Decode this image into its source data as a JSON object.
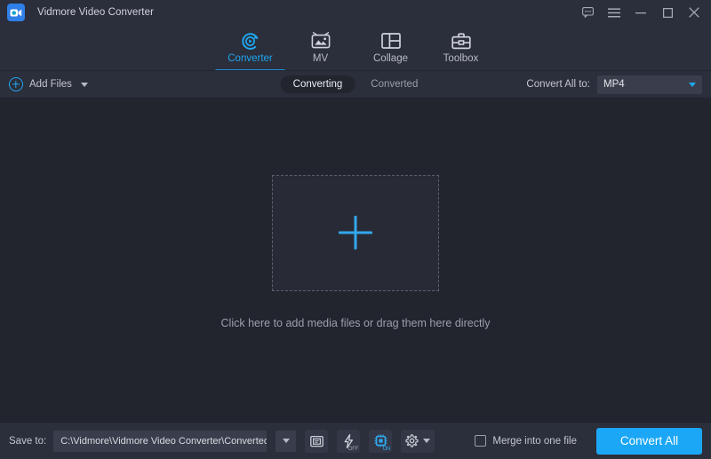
{
  "window": {
    "title": "Vidmore Video Converter",
    "logo_icon": "video-camera-icon",
    "controls": {
      "feedback_icon": "speech-bubble-icon",
      "menu_icon": "hamburger-menu-icon",
      "minimize_icon": "minimize-icon",
      "maximize_icon": "maximize-icon",
      "close_icon": "close-icon"
    }
  },
  "nav": {
    "tabs": [
      {
        "label": "Converter",
        "icon": "convert-circle-play-icon",
        "active": true
      },
      {
        "label": "MV",
        "icon": "photo-tv-icon",
        "active": false
      },
      {
        "label": "Collage",
        "icon": "collage-layout-icon",
        "active": false
      },
      {
        "label": "Toolbox",
        "icon": "toolbox-icon",
        "active": false
      }
    ]
  },
  "toolbar": {
    "add_files_label": "Add Files",
    "add_files_icon": "plus-circle-icon",
    "add_files_caret_icon": "chevron-down-icon",
    "segments": [
      {
        "label": "Converting",
        "active": true
      },
      {
        "label": "Converted",
        "active": false
      }
    ],
    "convert_all_to_label": "Convert All to:",
    "format_value": "MP4",
    "format_caret_icon": "chevron-down-icon"
  },
  "main": {
    "dropzone_plus_icon": "plus-icon",
    "hint": "Click here to add media files or drag them here directly"
  },
  "bottom": {
    "save_to_label": "Save to:",
    "save_to_path": "C:\\Vidmore\\Vidmore Video Converter\\Converted",
    "path_caret_icon": "chevron-down-icon",
    "tools": [
      {
        "name": "open-folder-icon",
        "badge": ""
      },
      {
        "name": "hardware-acceleration-bolt-icon",
        "badge": "OFF"
      },
      {
        "name": "gpu-chip-icon",
        "badge": "ON"
      },
      {
        "name": "settings-gear-icon",
        "badge": ""
      }
    ],
    "merge_label": "Merge into one file",
    "merge_checked": false,
    "convert_all_label": "Convert All"
  },
  "colors": {
    "accent": "#1ba7f5",
    "accent_nav": "#1fa8f0",
    "titlebar_bg": "#2b2e3b",
    "content_bg": "#22242e",
    "dropzone_bg": "#282b36",
    "field_bg": "#3a3e4c",
    "text_primary": "#d2d5de",
    "text_muted": "#9ba0ac",
    "badge_on": "#2fa8ef"
  }
}
